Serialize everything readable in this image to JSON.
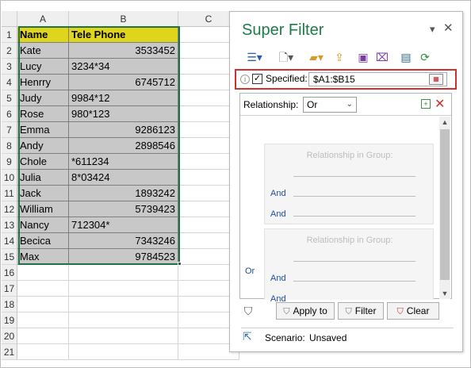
{
  "sheet": {
    "columns": [
      "A",
      "B",
      "C"
    ],
    "header": {
      "name": "Name",
      "phone": "Tele Phone"
    },
    "rows": [
      {
        "n": "1"
      },
      {
        "n": "2",
        "name": "Kate",
        "phone": "3533452"
      },
      {
        "n": "3",
        "name": "Lucy",
        "phone": "3234*34"
      },
      {
        "n": "4",
        "name": "Henrry",
        "phone": "6745712"
      },
      {
        "n": "5",
        "name": "Judy",
        "phone": "9984*12"
      },
      {
        "n": "6",
        "name": "Rose",
        "phone": "980*123"
      },
      {
        "n": "7",
        "name": "Emma",
        "phone": "9286123"
      },
      {
        "n": "8",
        "name": "Andy",
        "phone": "2898546"
      },
      {
        "n": "9",
        "name": "Chole",
        "phone": "*611234"
      },
      {
        "n": "10",
        "name": "Julia",
        "phone": "8*03424"
      },
      {
        "n": "11",
        "name": "Jack",
        "phone": "1893242"
      },
      {
        "n": "12",
        "name": "William",
        "phone": "5739423"
      },
      {
        "n": "13",
        "name": "Nancy",
        "phone": "712304*"
      },
      {
        "n": "14",
        "name": "Becica",
        "phone": "7343246"
      },
      {
        "n": "15",
        "name": "Max",
        "phone": "9784523"
      },
      {
        "n": "16"
      },
      {
        "n": "17"
      },
      {
        "n": "18"
      },
      {
        "n": "19"
      },
      {
        "n": "20"
      },
      {
        "n": "21"
      }
    ]
  },
  "panel": {
    "title": "Super Filter",
    "specified_label": "Specified:",
    "specified_checked": true,
    "range_value": "$A1:$B15",
    "relationship_label": "Relationship:",
    "relationship_value": "Or",
    "group_title": "Relationship in Group:",
    "and_label": "And",
    "or_label": "Or",
    "buttons": {
      "apply": "Apply to",
      "filter": "Filter",
      "clear": "Clear"
    },
    "scenario_label": "Scenario:",
    "scenario_value": "Unsaved"
  },
  "colors": {
    "header_fill": "#e0d51d",
    "data_fill": "#c8c8c8",
    "selection": "#217346",
    "title": "#1f7a4a",
    "highlight_box": "#cc3333"
  }
}
